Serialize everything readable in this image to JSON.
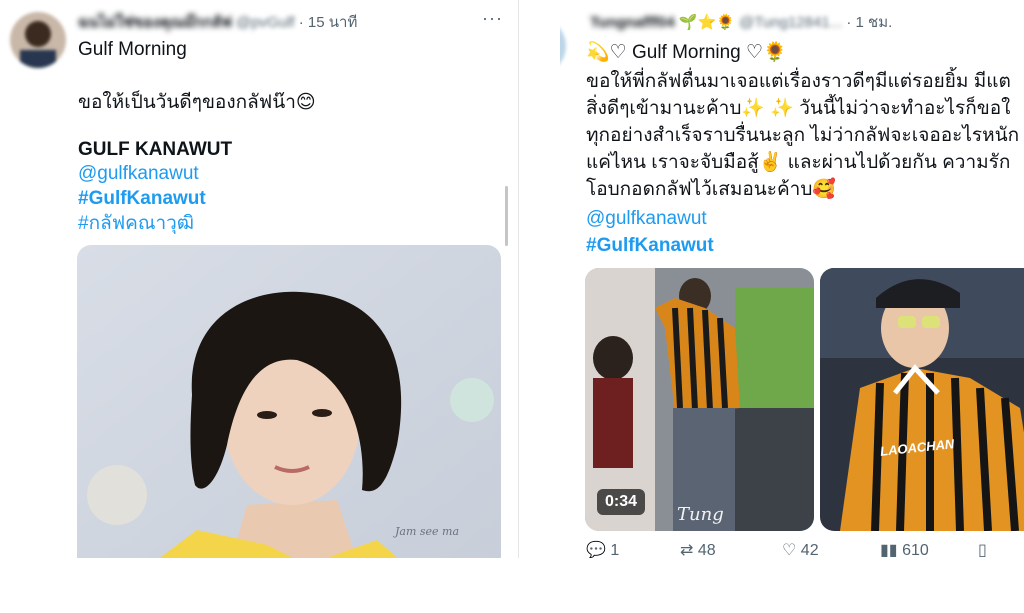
{
  "left_tweet": {
    "author_name": "ฉนไม่ใช่ของคุณม๊กกลัฟ",
    "author_handle": "@pvGulf",
    "time": "· 15 นาที",
    "more": "···",
    "line1": "Gulf Morning",
    "line2": "ขอให้เป็นวันดีๆของกลัฟน๊า😊",
    "name": "GULF KANAWUT",
    "mention": "@gulfkanawut",
    "hashtag1": "#GulfKanawut",
    "hashtag2": "#กลัฟคณาวุฒิ",
    "photo_watermark": "Jam see ma"
  },
  "right_tweet": {
    "author_name": "Tungnafff04",
    "author_emojis": "🌱⭐🌻",
    "author_handle": "@Tung12841...",
    "time": "· 1 ชม.",
    "line1": "💫♡ Gulf Morning ♡🌻",
    "body": [
      "ขอให้พี่กลัฟตื่นมาเจอแต่เรื่องราวดีๆมีแต่รอยยิ้ม มีแต",
      "สิ่งดีๆเข้ามานะค้าบ✨ ✨ วันนี้ไม่ว่าจะทำอะไรก็ขอใ",
      "ทุกอย่างสำเร็จราบรื่นนะลูก ไม่ว่ากลัฟจะเจออะไรหนัก",
      "แค่ไหน เราจะจับมือสู้✌️ และผ่านไปด้วยกัน ความรัก",
      "โอบกอดกลัฟไว้เสมอนะค้าบ🥰"
    ],
    "mention": "@gulfkanawut",
    "hashtag": "#GulfKanawut",
    "video_duration": "0:34",
    "video_watermark": "Tung",
    "shirt_text": "LAOACHAN",
    "actions": {
      "reply_count": "1",
      "retweet_count": "48",
      "like_count": "42",
      "view_count": "610"
    }
  },
  "icons": {
    "reply": "reply-icon",
    "retweet": "retweet-icon",
    "like": "heart-icon",
    "views": "views-icon",
    "bookmark": "bookmark-icon"
  }
}
